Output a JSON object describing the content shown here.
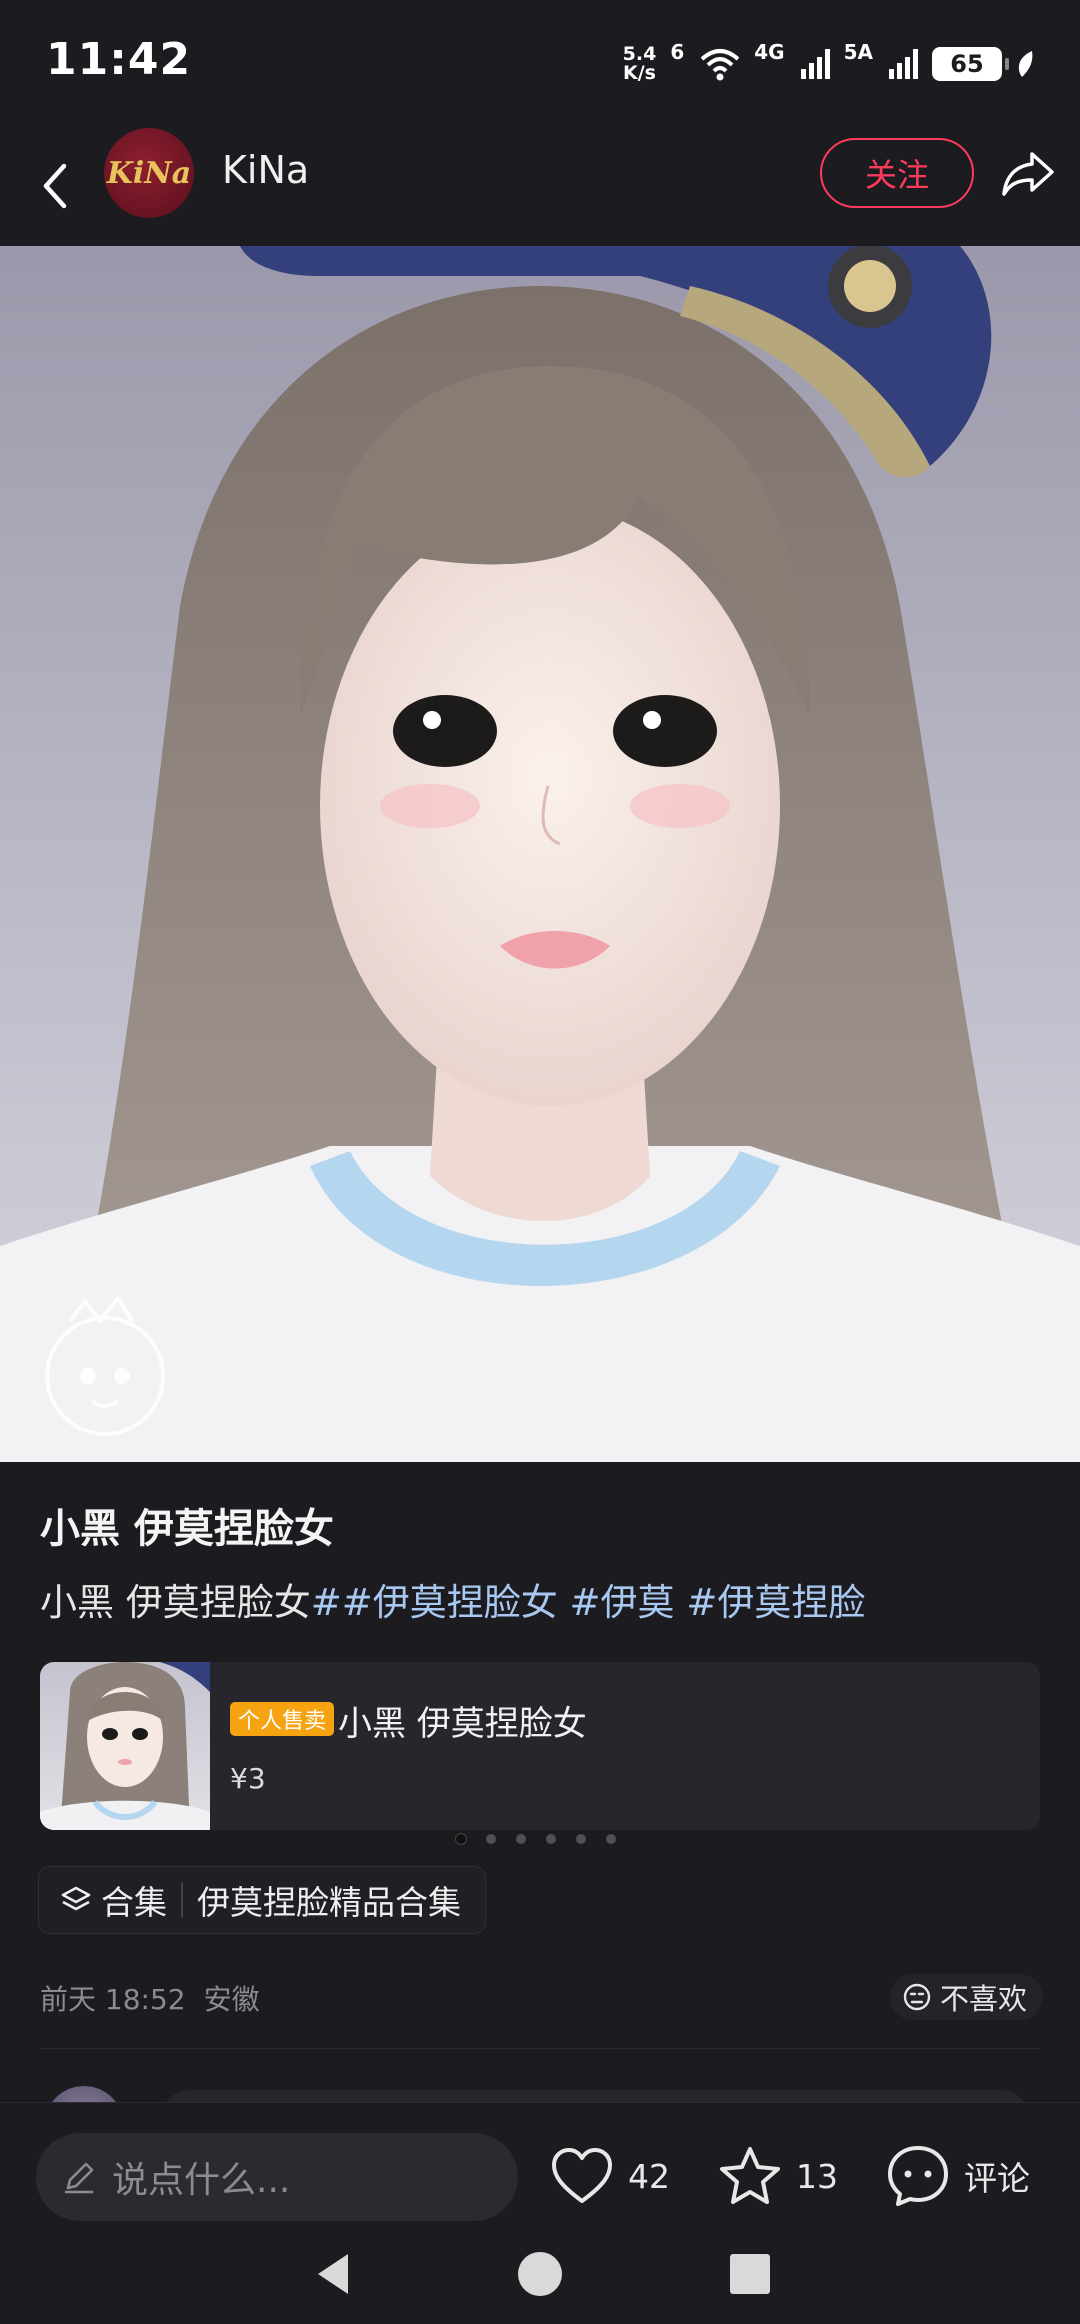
{
  "status_bar": {
    "time": "11:42",
    "net_speed_value": "5.4",
    "net_speed_unit": "K/s",
    "wifi_label": "6",
    "sig1_label": "4G",
    "sig2_label": "5A",
    "battery": "65"
  },
  "header": {
    "author_name": "KiNa",
    "avatar_text": "KiNa",
    "follow_label": "关注",
    "accent_color": "#ff3b5c"
  },
  "post": {
    "title": "小黑 伊莫捏脸女",
    "desc_text": "小黑 伊莫捏脸女",
    "desc_tags": [
      "##伊莫捏脸女",
      "#伊莫",
      "#伊莫捏脸"
    ]
  },
  "product": {
    "badge": "个人售卖",
    "name": "小黑 伊莫捏脸女",
    "price": "¥3",
    "badge_color": "#f5a311"
  },
  "carousel": {
    "count": 6,
    "active_index": 0
  },
  "collection": {
    "label": "合集",
    "name": "伊莫捏脸精品合集"
  },
  "meta": {
    "time": "前天 18:52",
    "location": "安徽",
    "dislike_label": "不喜欢"
  },
  "bottom_bar": {
    "comment_placeholder": "说点什么...",
    "likes": "42",
    "stars": "13",
    "comment_label": "评论"
  },
  "icons": [
    "back-icon",
    "share-icon",
    "wifi-icon",
    "signal-icon",
    "battery-icon",
    "layers-icon",
    "dislike-face-icon",
    "pencil-icon",
    "heart-icon",
    "star-icon",
    "comment-icon",
    "nav-back-icon",
    "nav-home-icon",
    "nav-recents-icon"
  ]
}
